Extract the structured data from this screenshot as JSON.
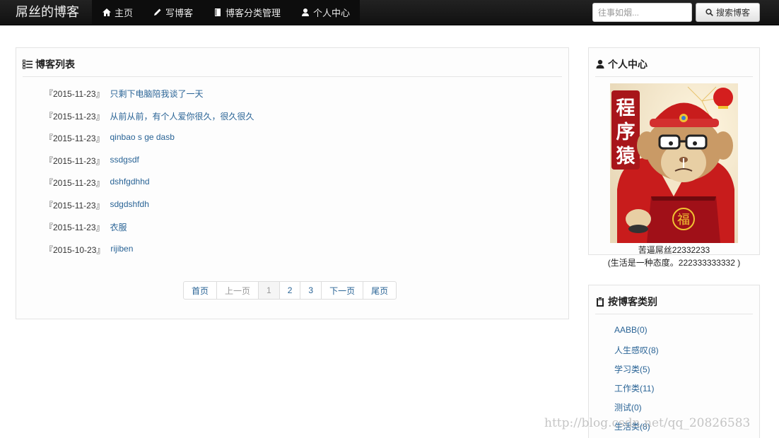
{
  "navbar": {
    "brand": "屌丝的博客",
    "items": [
      {
        "label": "主页",
        "icon": "home-icon"
      },
      {
        "label": "写博客",
        "icon": "pencil-icon"
      },
      {
        "label": "博客分类管理",
        "icon": "book-icon"
      },
      {
        "label": "个人中心",
        "icon": "user-icon"
      }
    ],
    "search": {
      "placeholder": "往事如烟...",
      "button_label": "搜索博客",
      "button_icon": "search-icon"
    },
    "colors": {
      "background": "#1b1b1b",
      "text": "#e8e8e8"
    }
  },
  "blog_panel": {
    "title": "博客列表",
    "icon": "list-icon",
    "posts": [
      {
        "date": "『2015-11-23』",
        "title": "只剩下电脑陪我谈了一天"
      },
      {
        "date": "『2015-11-23』",
        "title": "从前从前，有个人爱你很久，很久很久"
      },
      {
        "date": "『2015-11-23』",
        "title": "qinbao s ge dasb"
      },
      {
        "date": "『2015-11-23』",
        "title": "ssdgsdf"
      },
      {
        "date": "『2015-11-23』",
        "title": "dshfgdhhd"
      },
      {
        "date": "『2015-11-23』",
        "title": "sdgdshfdh"
      },
      {
        "date": "『2015-11-23』",
        "title": "衣服"
      },
      {
        "date": "『2015-10-23』",
        "title": "rijiben"
      }
    ],
    "pagination": {
      "first": "首页",
      "prev": "上一页",
      "pages": [
        "1",
        "2",
        "3"
      ],
      "current": "1",
      "next": "下一页",
      "last": "尾页"
    }
  },
  "profile_panel": {
    "title": "个人中心",
    "icon": "user-icon",
    "avatar_text": "程序猿",
    "avatar_badge": "福",
    "nickname": "苦逼屌丝22332233",
    "motto": "(生活是一种态度。222333333332 )"
  },
  "category_panel": {
    "title": "按博客类别",
    "icon": "clipboard-icon",
    "categories": [
      "AABB(0)",
      "人生感叹(8)",
      "学习类(5)",
      "工作类(11)",
      "测试(0)",
      "生活类(8)"
    ]
  },
  "watermark": "http://blog.csdn.net/qq_20826583",
  "colors": {
    "link": "#2a6496",
    "panel_border": "#e3e3e3"
  }
}
